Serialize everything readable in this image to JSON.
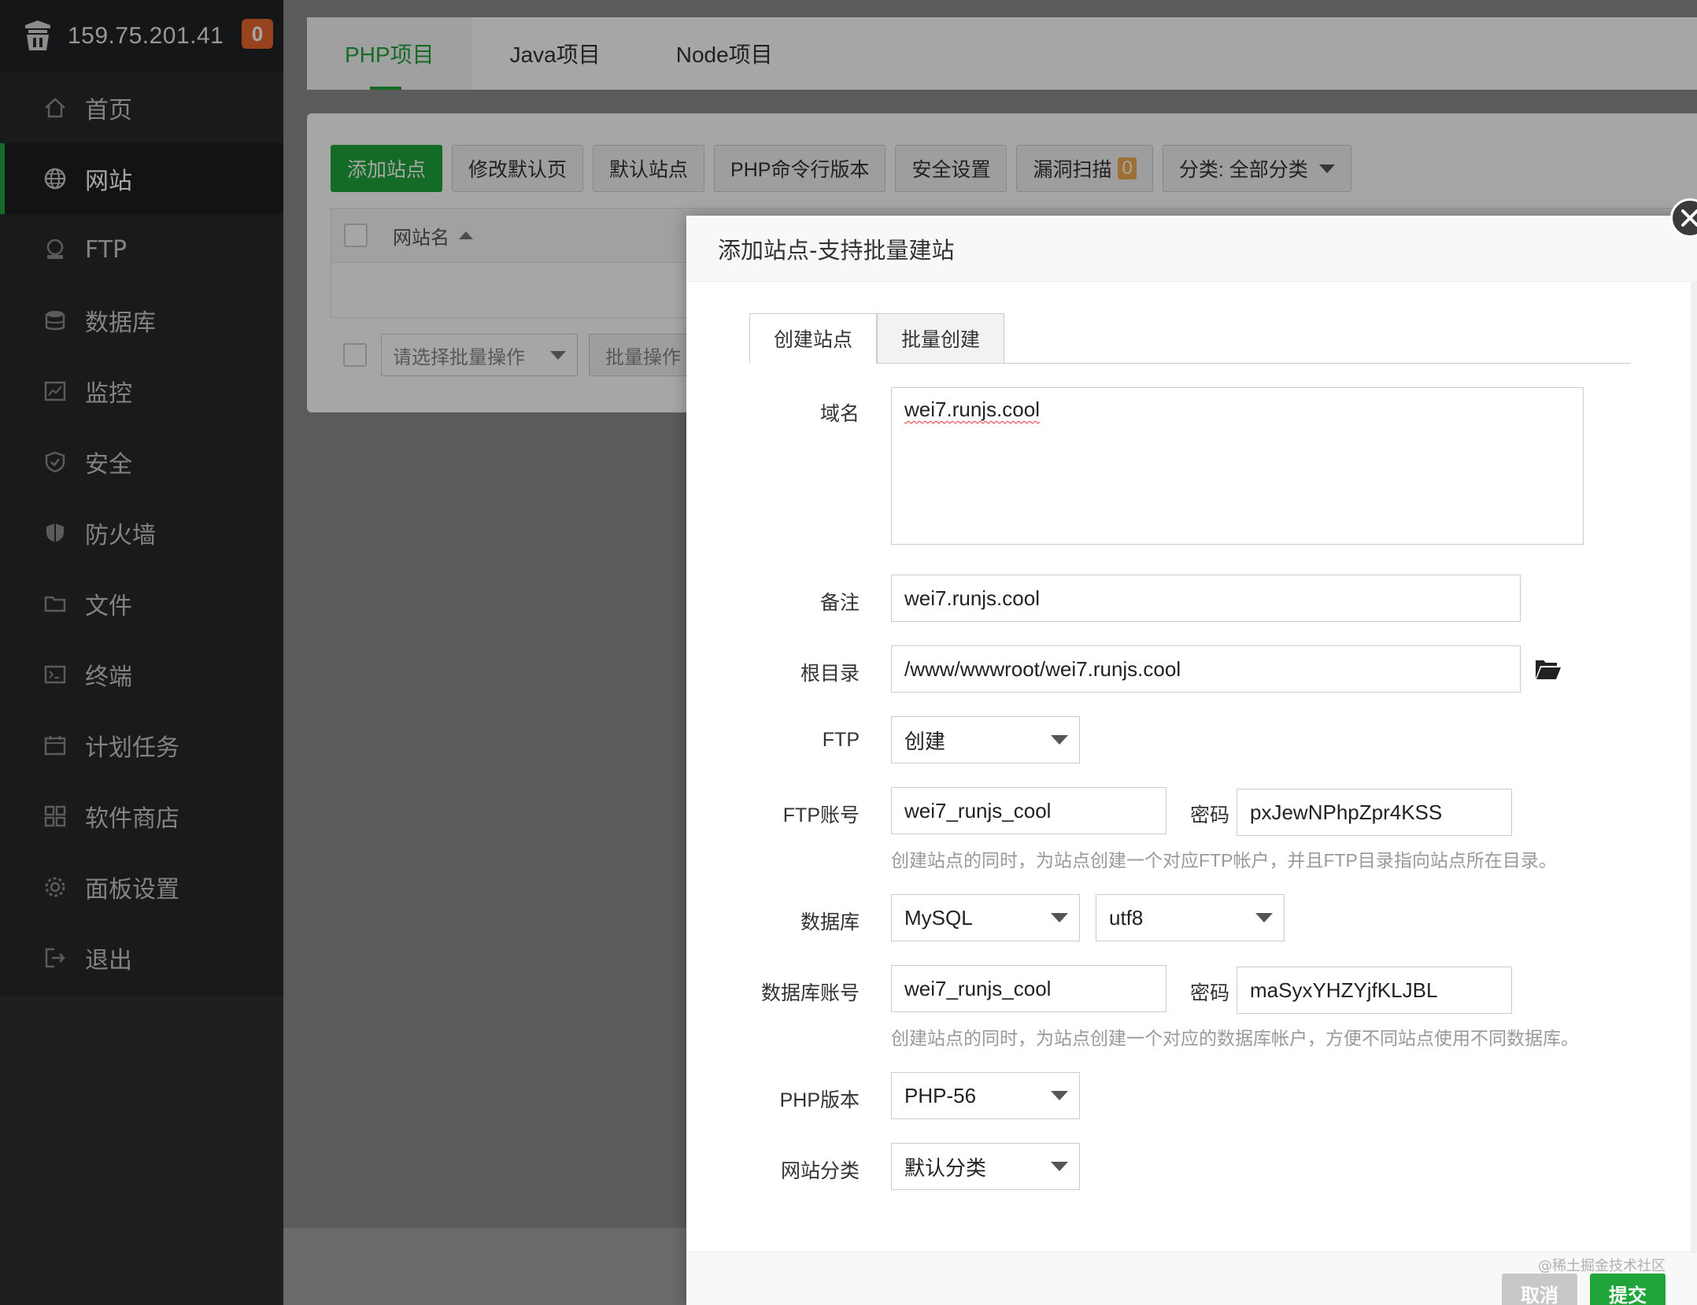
{
  "sidebar": {
    "server_ip": "159.75.201.41",
    "badge_count": "0",
    "items": [
      {
        "label": "首页",
        "icon": "home-icon"
      },
      {
        "label": "网站",
        "icon": "globe-icon",
        "active": true
      },
      {
        "label": "FTP",
        "icon": "ftp-icon"
      },
      {
        "label": "数据库",
        "icon": "database-icon"
      },
      {
        "label": "监控",
        "icon": "monitor-icon"
      },
      {
        "label": "安全",
        "icon": "shield-check-icon"
      },
      {
        "label": "防火墙",
        "icon": "firewall-shield-icon"
      },
      {
        "label": "文件",
        "icon": "folder-icon"
      },
      {
        "label": "终端",
        "icon": "terminal-icon"
      },
      {
        "label": "计划任务",
        "icon": "calendar-icon"
      },
      {
        "label": "软件商店",
        "icon": "grid-apps-icon"
      },
      {
        "label": "面板设置",
        "icon": "gear-icon"
      },
      {
        "label": "退出",
        "icon": "logout-icon"
      }
    ]
  },
  "project_tabs": [
    "PHP项目",
    "Java项目",
    "Node项目"
  ],
  "toolbar": {
    "add_site": "添加站点",
    "edit_default_page": "修改默认页",
    "default_site": "默认站点",
    "php_cli_version": "PHP命令行版本",
    "security_settings": "安全设置",
    "vuln_scan": "漏洞扫描",
    "vuln_count": "0",
    "category_filter": "分类: 全部分类"
  },
  "table": {
    "col_site_name": "网站名",
    "bulk_placeholder": "请选择批量操作",
    "bulk_button": "批量操作"
  },
  "dialog": {
    "title": "添加站点-支持批量建站",
    "tabs": [
      "创建站点",
      "批量创建"
    ],
    "labels": {
      "domain": "域名",
      "remark": "备注",
      "root_dir": "根目录",
      "ftp": "FTP",
      "ftp_account": "FTP账号",
      "password": "密码",
      "database": "数据库",
      "db_account": "数据库账号",
      "php_version": "PHP版本",
      "site_category": "网站分类"
    },
    "values": {
      "domain": "wei7.runjs.cool",
      "remark": "wei7.runjs.cool",
      "root_dir": "/www/wwwroot/wei7.runjs.cool",
      "ftp": "创建",
      "ftp_account": "wei7_runjs_cool",
      "ftp_password": "pxJewNPhpZpr4KSS",
      "db_type": "MySQL",
      "db_charset": "utf8",
      "db_account": "wei7_runjs_cool",
      "db_password": "maSyxYHZYjfKLJBL",
      "php_version": "PHP-56",
      "site_category": "默认分类"
    },
    "hints": {
      "ftp": "创建站点的同时，为站点创建一个对应FTP帐户，并且FTP目录指向站点所在目录。",
      "db": "创建站点的同时，为站点创建一个对应的数据库帐户，方便不同站点使用不同数据库。"
    },
    "footer": {
      "cancel": "取消",
      "submit": "提交",
      "watermark": "@稀土掘金技术社区"
    }
  },
  "colors": {
    "accent": "#20a53a",
    "badge": "#e9672f",
    "sidebar_bg": "#26292c"
  }
}
